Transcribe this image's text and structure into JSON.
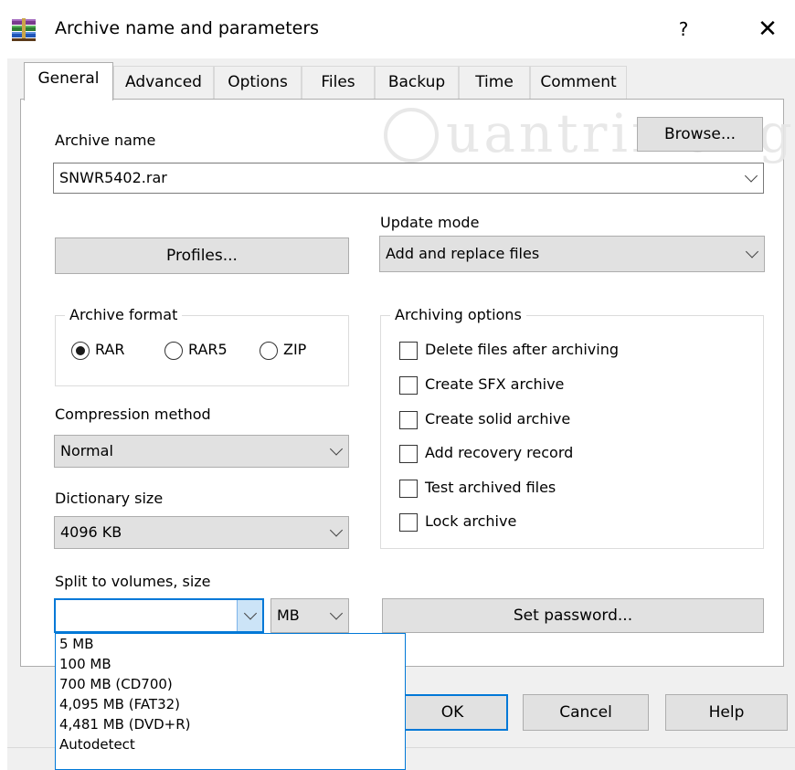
{
  "window": {
    "title": "Archive name and parameters",
    "help_label": "?",
    "close_label": "✕"
  },
  "tabs": [
    {
      "label": "General",
      "active": true
    },
    {
      "label": "Advanced"
    },
    {
      "label": "Options"
    },
    {
      "label": "Files"
    },
    {
      "label": "Backup"
    },
    {
      "label": "Time"
    },
    {
      "label": "Comment"
    }
  ],
  "general": {
    "archive_name_label": "Archive name",
    "archive_name_value": "SNWR5402.rar",
    "browse_label": "Browse...",
    "profiles_label": "Profiles...",
    "update_mode_label": "Update mode",
    "update_mode_value": "Add and replace files",
    "archive_format": {
      "title": "Archive format",
      "options": [
        "RAR",
        "RAR5",
        "ZIP"
      ],
      "selected": "RAR"
    },
    "archiving_options": {
      "title": "Archiving options",
      "items": [
        {
          "label": "Delete files after archiving",
          "checked": false
        },
        {
          "label": "Create SFX archive",
          "checked": false
        },
        {
          "label": "Create solid archive",
          "checked": false
        },
        {
          "label": "Add recovery record",
          "checked": false
        },
        {
          "label": "Test archived files",
          "checked": false
        },
        {
          "label": "Lock archive",
          "checked": false
        }
      ]
    },
    "compression_method_label": "Compression method",
    "compression_method_value": "Normal",
    "dictionary_size_label": "Dictionary size",
    "dictionary_size_value": "4096 KB",
    "split_volumes_label": "Split to volumes, size",
    "split_volumes_value": "",
    "split_unit_value": "MB",
    "split_options": [
      "5 MB",
      "100 MB",
      "700 MB  (CD700)",
      "4,095 MB  (FAT32)",
      "4,481 MB  (DVD+R)",
      "Autodetect"
    ],
    "set_password_label": "Set password..."
  },
  "footer": {
    "ok_label": "OK",
    "cancel_label": "Cancel",
    "help_label": "Help"
  },
  "watermark": {
    "text": "uantrimang"
  },
  "icons": {
    "app": "winrar-books-icon",
    "close": "close-icon",
    "chevron": "chevron-down-icon"
  },
  "colors": {
    "accent": "#0078d7",
    "button_face": "#e1e1e1",
    "dialog_face": "#f0f0f0"
  }
}
